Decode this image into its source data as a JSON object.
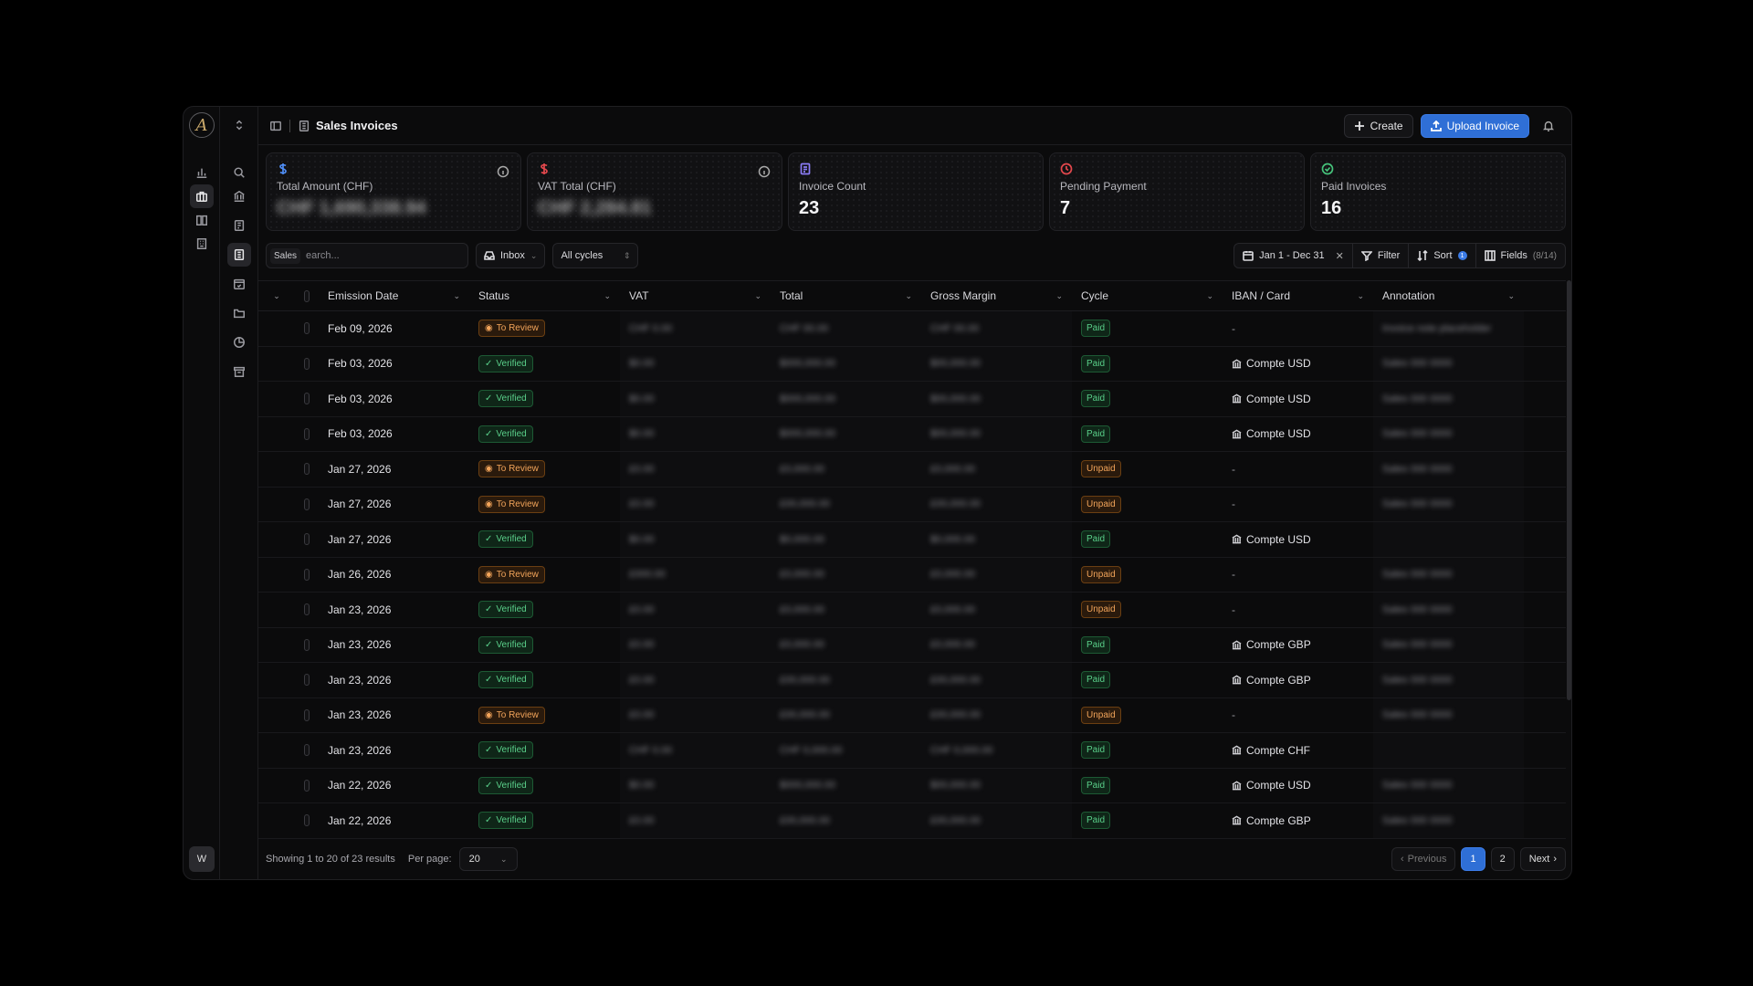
{
  "header": {
    "title": "Sales Invoices",
    "create_label": "Create",
    "upload_label": "Upload Invoice"
  },
  "user": {
    "initial": "W"
  },
  "stats": [
    {
      "icon": "dollar-icon",
      "label": "Total Amount (CHF)",
      "value": "CHF 1,690,338.94",
      "blurred": true,
      "color": "#4f8ef7"
    },
    {
      "icon": "dollar-icon",
      "label": "VAT Total (CHF)",
      "value": "CHF 2,284.81",
      "blurred": true,
      "color": "#e5484d"
    },
    {
      "icon": "document-icon",
      "label": "Invoice Count",
      "value": "23",
      "blurred": false,
      "color": "#8b7cf6"
    },
    {
      "icon": "clock-icon",
      "label": "Pending Payment",
      "value": "7",
      "blurred": false,
      "color": "#e5484d"
    },
    {
      "icon": "check-circle-icon",
      "label": "Paid Invoices",
      "value": "16",
      "blurred": false,
      "color": "#46c37b"
    }
  ],
  "toolbar": {
    "search_tag": "Sales",
    "search_placeholder": "earch...",
    "inbox_label": "Inbox",
    "cycles_label": "All cycles",
    "date_range": "Jan 1 - Dec 31",
    "filter_label": "Filter",
    "sort_label": "Sort",
    "sort_count": "1",
    "fields_label": "Fields",
    "fields_count": "(8/14)"
  },
  "columns": [
    "Emission Date",
    "Status",
    "VAT",
    "Total",
    "Gross Margin",
    "Cycle",
    "IBAN / Card",
    "Annotation"
  ],
  "rows": [
    {
      "date": "Feb 09, 2026",
      "status": "To Review",
      "vat": "CHF 0.00",
      "total": "CHF 00.00",
      "margin": "CHF 00.00",
      "cycle": "Paid",
      "iban": "-",
      "annotation": "Invoice note placeholder"
    },
    {
      "date": "Feb 03, 2026",
      "status": "Verified",
      "vat": "$0.00",
      "total": "$000,000.00",
      "margin": "$00,000.00",
      "cycle": "Paid",
      "iban": "Compte USD",
      "annotation": "Sales 000 0000"
    },
    {
      "date": "Feb 03, 2026",
      "status": "Verified",
      "vat": "$0.00",
      "total": "$000,000.00",
      "margin": "$00,000.00",
      "cycle": "Paid",
      "iban": "Compte USD",
      "annotation": "Sales 000 0000"
    },
    {
      "date": "Feb 03, 2026",
      "status": "Verified",
      "vat": "$0.00",
      "total": "$000,000.00",
      "margin": "$00,000.00",
      "cycle": "Paid",
      "iban": "Compte USD",
      "annotation": "Sales 000 0000"
    },
    {
      "date": "Jan 27, 2026",
      "status": "To Review",
      "vat": "£0.00",
      "total": "£0,000.00",
      "margin": "£0,000.00",
      "cycle": "Unpaid",
      "iban": "-",
      "annotation": "Sales 000 0000"
    },
    {
      "date": "Jan 27, 2026",
      "status": "To Review",
      "vat": "£0.00",
      "total": "£00,000.00",
      "margin": "£00,000.00",
      "cycle": "Unpaid",
      "iban": "-",
      "annotation": "Sales 000 0000"
    },
    {
      "date": "Jan 27, 2026",
      "status": "Verified",
      "vat": "$0.00",
      "total": "$0,000.00",
      "margin": "$0,000.00",
      "cycle": "Paid",
      "iban": "Compte USD",
      "annotation": ""
    },
    {
      "date": "Jan 26, 2026",
      "status": "To Review",
      "vat": "£000.00",
      "total": "£0,000.00",
      "margin": "£0,000.00",
      "cycle": "Unpaid",
      "iban": "-",
      "annotation": "Sales 000 0000"
    },
    {
      "date": "Jan 23, 2026",
      "status": "Verified",
      "vat": "£0.00",
      "total": "£0,000.00",
      "margin": "£0,000.00",
      "cycle": "Unpaid",
      "iban": "-",
      "annotation": "Sales 000 0000"
    },
    {
      "date": "Jan 23, 2026",
      "status": "Verified",
      "vat": "£0.00",
      "total": "£0,000.00",
      "margin": "£0,000.00",
      "cycle": "Paid",
      "iban": "Compte GBP",
      "annotation": "Sales 000 0000"
    },
    {
      "date": "Jan 23, 2026",
      "status": "Verified",
      "vat": "£0.00",
      "total": "£00,000.00",
      "margin": "£00,000.00",
      "cycle": "Paid",
      "iban": "Compte GBP",
      "annotation": "Sales 000 0000"
    },
    {
      "date": "Jan 23, 2026",
      "status": "To Review",
      "vat": "£0.00",
      "total": "£00,000.00",
      "margin": "£00,000.00",
      "cycle": "Unpaid",
      "iban": "-",
      "annotation": "Sales 000 0000"
    },
    {
      "date": "Jan 23, 2026",
      "status": "Verified",
      "vat": "CHF 0.00",
      "total": "CHF 0,000.00",
      "margin": "CHF 0,000.00",
      "cycle": "Paid",
      "iban": "Compte CHF",
      "annotation": ""
    },
    {
      "date": "Jan 22, 2026",
      "status": "Verified",
      "vat": "$0.00",
      "total": "$000,000.00",
      "margin": "$00,000.00",
      "cycle": "Paid",
      "iban": "Compte USD",
      "annotation": "Sales 000 0000"
    },
    {
      "date": "Jan 22, 2026",
      "status": "Verified",
      "vat": "£0.00",
      "total": "£00,000.00",
      "margin": "£00,000.00",
      "cycle": "Paid",
      "iban": "Compte GBP",
      "annotation": "Sales 000 0000"
    }
  ],
  "footer": {
    "showing": "Showing 1 to 20 of 23 results",
    "per_page_label": "Per page:",
    "per_page_value": "20",
    "prev_label": "Previous",
    "next_label": "Next",
    "pages": [
      "1",
      "2"
    ]
  }
}
